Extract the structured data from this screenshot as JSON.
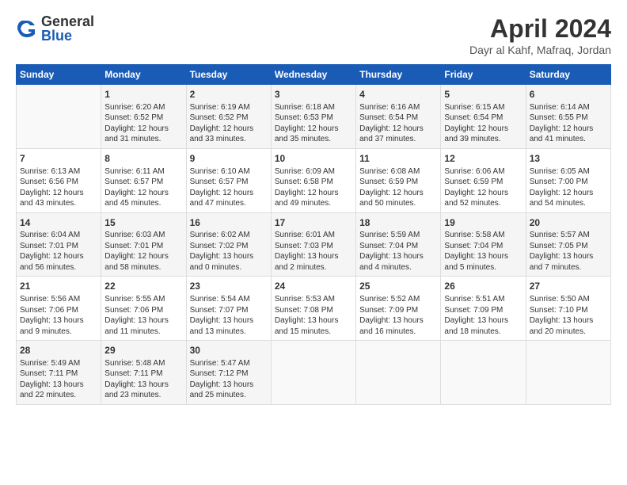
{
  "header": {
    "logo_general": "General",
    "logo_blue": "Blue",
    "title": "April 2024",
    "location": "Dayr al Kahf, Mafraq, Jordan"
  },
  "days_of_week": [
    "Sunday",
    "Monday",
    "Tuesday",
    "Wednesday",
    "Thursday",
    "Friday",
    "Saturday"
  ],
  "weeks": [
    [
      {
        "day": "",
        "text": ""
      },
      {
        "day": "1",
        "text": "Sunrise: 6:20 AM\nSunset: 6:52 PM\nDaylight: 12 hours\nand 31 minutes."
      },
      {
        "day": "2",
        "text": "Sunrise: 6:19 AM\nSunset: 6:52 PM\nDaylight: 12 hours\nand 33 minutes."
      },
      {
        "day": "3",
        "text": "Sunrise: 6:18 AM\nSunset: 6:53 PM\nDaylight: 12 hours\nand 35 minutes."
      },
      {
        "day": "4",
        "text": "Sunrise: 6:16 AM\nSunset: 6:54 PM\nDaylight: 12 hours\nand 37 minutes."
      },
      {
        "day": "5",
        "text": "Sunrise: 6:15 AM\nSunset: 6:54 PM\nDaylight: 12 hours\nand 39 minutes."
      },
      {
        "day": "6",
        "text": "Sunrise: 6:14 AM\nSunset: 6:55 PM\nDaylight: 12 hours\nand 41 minutes."
      }
    ],
    [
      {
        "day": "7",
        "text": "Sunrise: 6:13 AM\nSunset: 6:56 PM\nDaylight: 12 hours\nand 43 minutes."
      },
      {
        "day": "8",
        "text": "Sunrise: 6:11 AM\nSunset: 6:57 PM\nDaylight: 12 hours\nand 45 minutes."
      },
      {
        "day": "9",
        "text": "Sunrise: 6:10 AM\nSunset: 6:57 PM\nDaylight: 12 hours\nand 47 minutes."
      },
      {
        "day": "10",
        "text": "Sunrise: 6:09 AM\nSunset: 6:58 PM\nDaylight: 12 hours\nand 49 minutes."
      },
      {
        "day": "11",
        "text": "Sunrise: 6:08 AM\nSunset: 6:59 PM\nDaylight: 12 hours\nand 50 minutes."
      },
      {
        "day": "12",
        "text": "Sunrise: 6:06 AM\nSunset: 6:59 PM\nDaylight: 12 hours\nand 52 minutes."
      },
      {
        "day": "13",
        "text": "Sunrise: 6:05 AM\nSunset: 7:00 PM\nDaylight: 12 hours\nand 54 minutes."
      }
    ],
    [
      {
        "day": "14",
        "text": "Sunrise: 6:04 AM\nSunset: 7:01 PM\nDaylight: 12 hours\nand 56 minutes."
      },
      {
        "day": "15",
        "text": "Sunrise: 6:03 AM\nSunset: 7:01 PM\nDaylight: 12 hours\nand 58 minutes."
      },
      {
        "day": "16",
        "text": "Sunrise: 6:02 AM\nSunset: 7:02 PM\nDaylight: 13 hours\nand 0 minutes."
      },
      {
        "day": "17",
        "text": "Sunrise: 6:01 AM\nSunset: 7:03 PM\nDaylight: 13 hours\nand 2 minutes."
      },
      {
        "day": "18",
        "text": "Sunrise: 5:59 AM\nSunset: 7:04 PM\nDaylight: 13 hours\nand 4 minutes."
      },
      {
        "day": "19",
        "text": "Sunrise: 5:58 AM\nSunset: 7:04 PM\nDaylight: 13 hours\nand 5 minutes."
      },
      {
        "day": "20",
        "text": "Sunrise: 5:57 AM\nSunset: 7:05 PM\nDaylight: 13 hours\nand 7 minutes."
      }
    ],
    [
      {
        "day": "21",
        "text": "Sunrise: 5:56 AM\nSunset: 7:06 PM\nDaylight: 13 hours\nand 9 minutes."
      },
      {
        "day": "22",
        "text": "Sunrise: 5:55 AM\nSunset: 7:06 PM\nDaylight: 13 hours\nand 11 minutes."
      },
      {
        "day": "23",
        "text": "Sunrise: 5:54 AM\nSunset: 7:07 PM\nDaylight: 13 hours\nand 13 minutes."
      },
      {
        "day": "24",
        "text": "Sunrise: 5:53 AM\nSunset: 7:08 PM\nDaylight: 13 hours\nand 15 minutes."
      },
      {
        "day": "25",
        "text": "Sunrise: 5:52 AM\nSunset: 7:09 PM\nDaylight: 13 hours\nand 16 minutes."
      },
      {
        "day": "26",
        "text": "Sunrise: 5:51 AM\nSunset: 7:09 PM\nDaylight: 13 hours\nand 18 minutes."
      },
      {
        "day": "27",
        "text": "Sunrise: 5:50 AM\nSunset: 7:10 PM\nDaylight: 13 hours\nand 20 minutes."
      }
    ],
    [
      {
        "day": "28",
        "text": "Sunrise: 5:49 AM\nSunset: 7:11 PM\nDaylight: 13 hours\nand 22 minutes."
      },
      {
        "day": "29",
        "text": "Sunrise: 5:48 AM\nSunset: 7:11 PM\nDaylight: 13 hours\nand 23 minutes."
      },
      {
        "day": "30",
        "text": "Sunrise: 5:47 AM\nSunset: 7:12 PM\nDaylight: 13 hours\nand 25 minutes."
      },
      {
        "day": "",
        "text": ""
      },
      {
        "day": "",
        "text": ""
      },
      {
        "day": "",
        "text": ""
      },
      {
        "day": "",
        "text": ""
      }
    ]
  ]
}
